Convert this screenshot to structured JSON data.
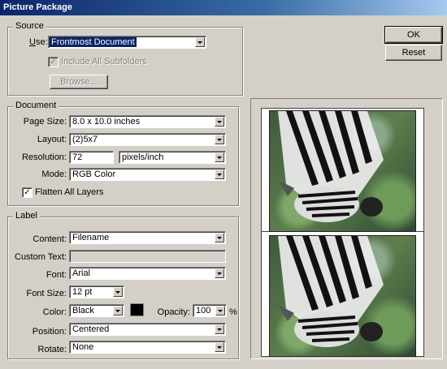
{
  "window": {
    "title": "Picture Package"
  },
  "buttons": {
    "ok": "OK",
    "reset": "Reset"
  },
  "source": {
    "legend": "Source",
    "use_label_u": "U",
    "use_label_rest": "se:",
    "use_value": "Frontmost Document",
    "include_subfolders": "Include All Subfolders",
    "browse": "Browse..."
  },
  "document": {
    "legend": "Document",
    "page_size_label": "Page Size:",
    "page_size_value": "8.0 x 10.0 inches",
    "layout_label": "Layout:",
    "layout_value": "(2)5x7",
    "resolution_label": "Resolution:",
    "resolution_value": "72",
    "resolution_unit": "pixels/inch",
    "mode_label": "Mode:",
    "mode_value": "RGB Color",
    "flatten_label": "Flatten All Layers",
    "flatten_checked": true
  },
  "label": {
    "legend": "Label",
    "content_label": "Content:",
    "content_value": "Filename",
    "custom_text_label": "Custom Text:",
    "custom_text_value": "",
    "font_label": "Font:",
    "font_value": "Arial",
    "font_size_label": "Font Size:",
    "font_size_value": "12 pt",
    "color_label": "Color:",
    "color_value": "Black",
    "swatch_color": "#000000",
    "opacity_label": "Opacity:",
    "opacity_value": "100",
    "opacity_unit": "%",
    "position_label": "Position:",
    "position_value": "Centered",
    "rotate_label": "Rotate:",
    "rotate_value": "None"
  },
  "preview": {
    "photo_count": 2
  }
}
